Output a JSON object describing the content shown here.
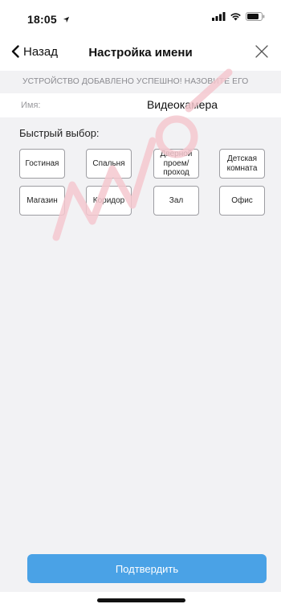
{
  "status_bar": {
    "time": "18:05",
    "icons": [
      "location-arrow-icon",
      "cellular-signal-icon",
      "wifi-icon",
      "battery-icon"
    ]
  },
  "nav": {
    "back_label": "Назад",
    "title": "Настройка имени"
  },
  "banner": {
    "text": "УСТРОЙСТВО ДОБАВЛЕНО УСПЕШНО! НАЗОВИТЕ ЕГО"
  },
  "name_field": {
    "label": "Имя:",
    "value": "Видеокамера"
  },
  "quick_select": {
    "title": "Быстрый выбор:",
    "options": [
      "Гостиная",
      "Спальня",
      "Дверной проем/ проход",
      "Детская комната",
      "Магазин",
      "Коридор",
      "Зал",
      "Офис"
    ]
  },
  "confirm": {
    "label": "Подтвердить"
  },
  "colors": {
    "accent": "#4aa2e6",
    "banner_bg": "#f2f2f4",
    "watermark": "#f5c8cf"
  }
}
